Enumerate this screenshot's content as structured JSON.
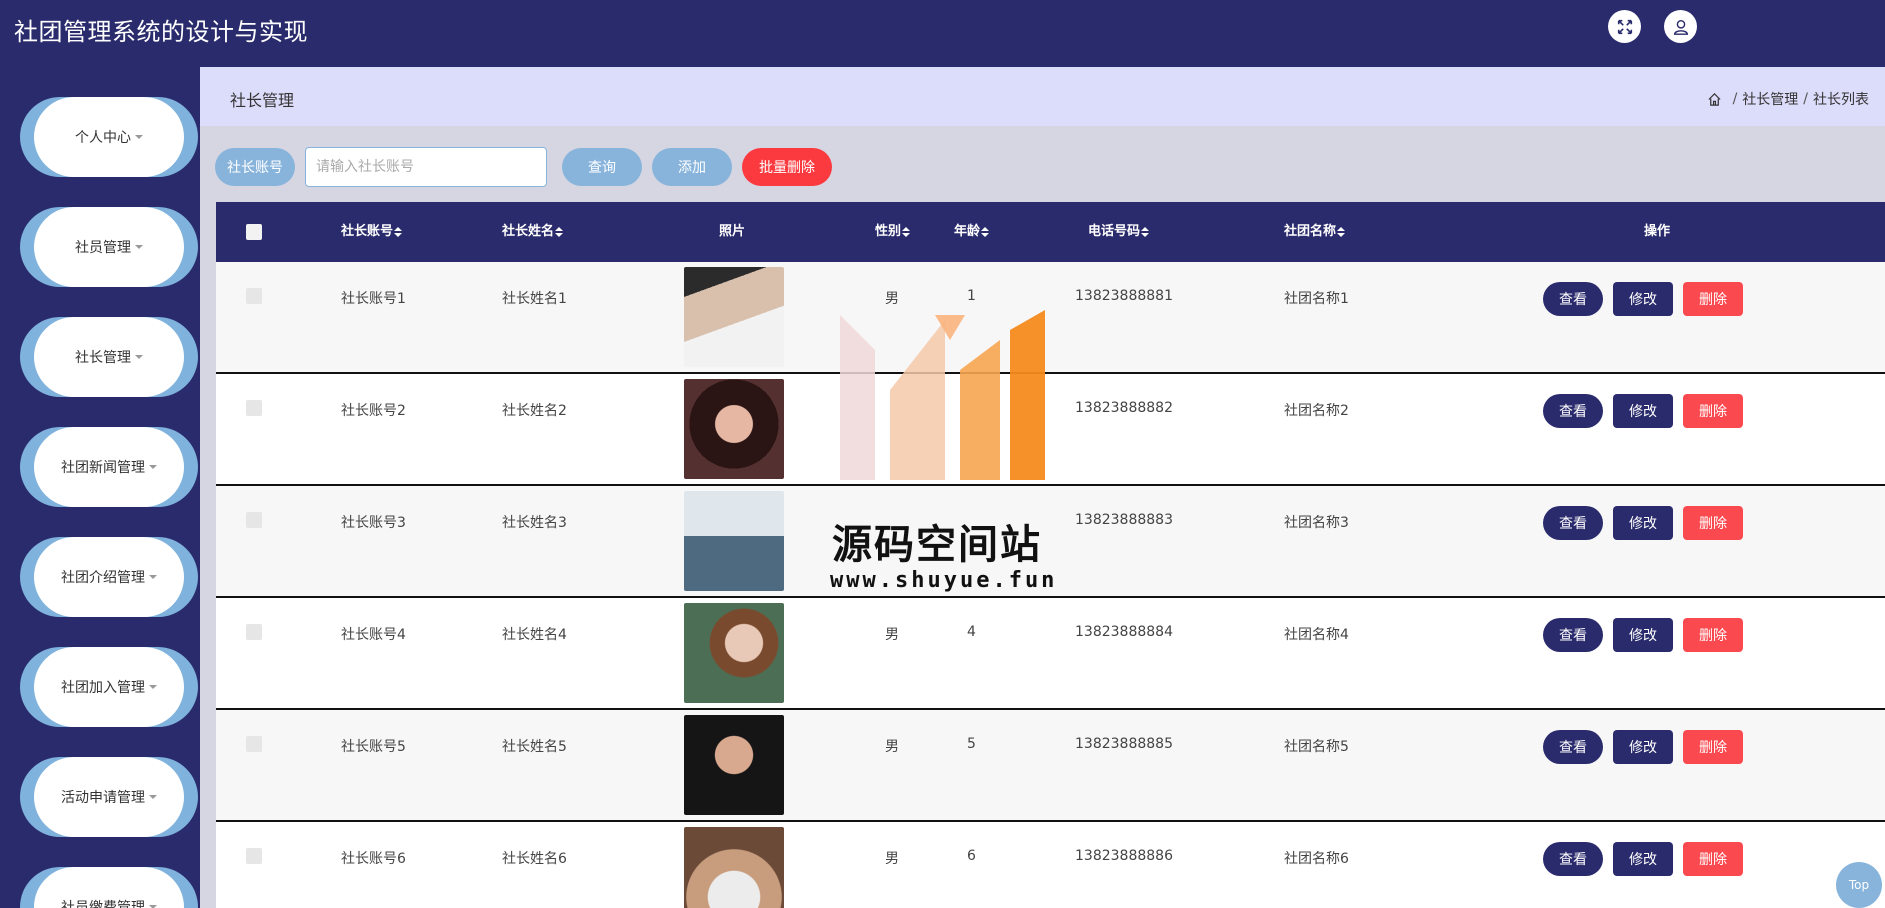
{
  "header": {
    "title": "社团管理系统的设计与实现",
    "fullscreen_icon": "expand-icon",
    "user_icon": "user-icon"
  },
  "sidebar": {
    "items": [
      {
        "label": "个人中心"
      },
      {
        "label": "社员管理"
      },
      {
        "label": "社长管理"
      },
      {
        "label": "社团新闻管理"
      },
      {
        "label": "社团介绍管理"
      },
      {
        "label": "社团加入管理"
      },
      {
        "label": "活动申请管理"
      },
      {
        "label": "社员缴费管理"
      }
    ]
  },
  "breadcrumb": {
    "title": "社长管理",
    "path": [
      "社长管理",
      "社长列表"
    ],
    "sep": "/"
  },
  "search": {
    "label": "社长账号",
    "placeholder": "请输入社长账号",
    "query_label": "查询",
    "add_label": "添加",
    "batch_delete_label": "批量删除"
  },
  "table": {
    "columns": {
      "account": "社长账号",
      "name": "社长姓名",
      "photo": "照片",
      "gender": "性别",
      "age": "年龄",
      "phone": "电话号码",
      "club": "社团名称",
      "actions": "操作"
    },
    "rows": [
      {
        "account": "社长账号1",
        "name": "社长姓名1",
        "gender": "男",
        "age": "1",
        "phone": "13823888881",
        "club": "社团名称1"
      },
      {
        "account": "社长账号2",
        "name": "社长姓名2",
        "gender": "",
        "age": "",
        "phone": "13823888882",
        "club": "社团名称2"
      },
      {
        "account": "社长账号3",
        "name": "社长姓名3",
        "gender": "",
        "age": "",
        "phone": "13823888883",
        "club": "社团名称3"
      },
      {
        "account": "社长账号4",
        "name": "社长姓名4",
        "gender": "男",
        "age": "4",
        "phone": "13823888884",
        "club": "社团名称4"
      },
      {
        "account": "社长账号5",
        "name": "社长姓名5",
        "gender": "男",
        "age": "5",
        "phone": "13823888885",
        "club": "社团名称5"
      },
      {
        "account": "社长账号6",
        "name": "社长姓名6",
        "gender": "男",
        "age": "6",
        "phone": "13823888886",
        "club": "社团名称6"
      }
    ],
    "view_label": "查看",
    "edit_label": "修改",
    "delete_label": "删除"
  },
  "watermark": {
    "text": "源码空间站",
    "url": "www.shuyue.fun"
  },
  "top_button": {
    "label": "Top"
  },
  "colors": {
    "primary": "#2a2b6c",
    "accent": "#88b4dc",
    "danger": "#fb3a3f",
    "breadcrumb_bg": "#dcdcfb"
  }
}
